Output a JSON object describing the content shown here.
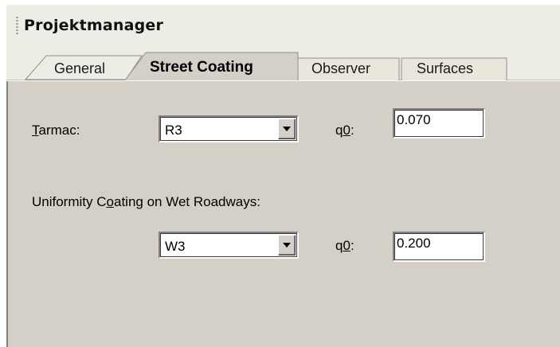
{
  "panel": {
    "title": "Projektmanager"
  },
  "tabs": [
    {
      "label": "General",
      "active": false
    },
    {
      "label": "Street Coating",
      "active": true
    },
    {
      "label": "Observer",
      "active": false
    },
    {
      "label": "Surfaces",
      "active": false
    }
  ],
  "tarmac": {
    "label_mnemonic": "T",
    "label_rest": "armac:",
    "selected": "R3",
    "q0_label_prefix": "q",
    "q0_label_mnemonic": "0",
    "q0_label_suffix": ":",
    "q0_value": "0.070"
  },
  "wet": {
    "label_before": "Uniformity C",
    "label_mnemonic": "o",
    "label_after": "ating on Wet Roadways:",
    "selected": "W3",
    "q0_label_prefix": "q",
    "q0_label_mnemonic": "0",
    "q0_label_suffix": ":",
    "q0_value": "0.200"
  },
  "icons": {
    "dropdown": "chevron-down-icon",
    "grip": "drag-grip-icon"
  },
  "colors": {
    "header_bg": "#eeede5",
    "client_bg": "#d4d0c8",
    "tab_inactive": "#e9e6dc"
  }
}
